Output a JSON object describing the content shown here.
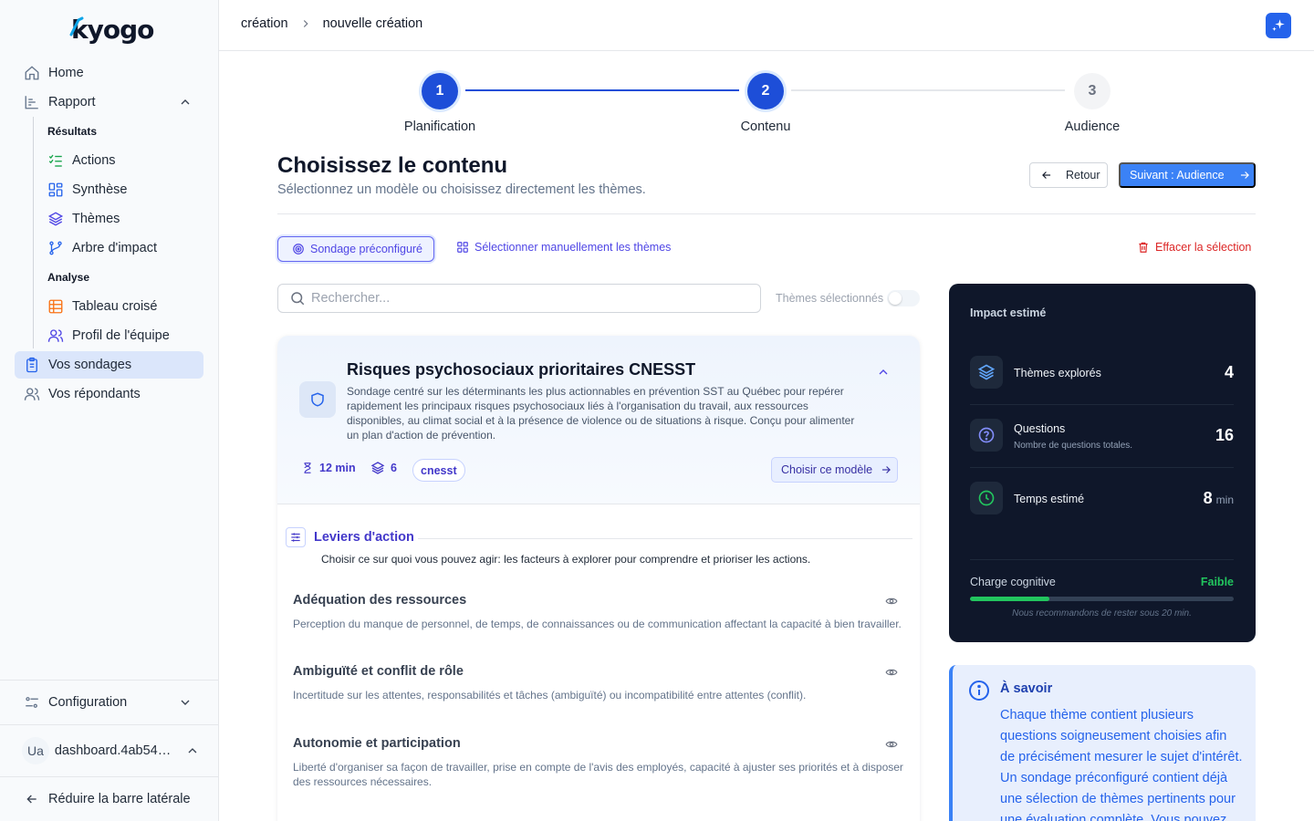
{
  "brand": {
    "logo_text": "kyogo",
    "accent": "#2563eb"
  },
  "sidebar": {
    "home": "Home",
    "rapport": "Rapport",
    "section_results": "Résultats",
    "actions": "Actions",
    "synthese": "Synthèse",
    "themes": "Thèmes",
    "arbre": "Arbre d'impact",
    "section_analysis": "Analyse",
    "tableau": "Tableau croisé",
    "profil": "Profil de l'équipe",
    "sondages": "Vos sondages",
    "repondants": "Vos répondants",
    "configuration": "Configuration",
    "user_initials": "Ua",
    "user_name": "dashboard.4ab541…",
    "collapse": "Réduire la barre latérale"
  },
  "header": {
    "breadcrumb": [
      "création",
      "nouvelle création"
    ]
  },
  "stepper": {
    "steps": [
      {
        "num": "1",
        "label": "Planification",
        "status": "done"
      },
      {
        "num": "2",
        "label": "Contenu",
        "status": "current"
      },
      {
        "num": "3",
        "label": "Audience",
        "status": "todo"
      }
    ]
  },
  "page": {
    "title": "Choisissez le contenu",
    "subtitle": "Sélectionnez un modèle ou choisissez directement les thèmes.",
    "back": "Retour",
    "next": "Suivant : Audience"
  },
  "tabs": {
    "preconfigured": "Sondage préconfiguré",
    "manual": "Sélectionner manuellement les thèmes",
    "clear": "Effacer la sélection"
  },
  "search": {
    "placeholder": "Rechercher...",
    "toggle_label": "Thèmes sélectionnés"
  },
  "template": {
    "title": "Risques psychosociaux prioritaires CNESST",
    "description": "Sondage centré sur les déterminants les plus actionnables en prévention SST au Québec pour repérer rapidement les principaux risques psychosociaux liés à l'organisation du travail, aux ressources disponibles, au climat social et à la présence de violence ou de situations à risque. Conçu pour alimenter un plan d'action de prévention.",
    "duration": "12 min",
    "themes_count": "6",
    "tag": "cnesst",
    "choose": "Choisir ce modèle",
    "category": {
      "title": "Leviers d'action",
      "description": "Choisir ce sur quoi vous pouvez agir: les facteurs à explorer pour comprendre et prioriser les actions."
    },
    "themes": [
      {
        "title": "Adéquation des ressources",
        "description": "Perception du manque de personnel, de temps, de connaissances ou de communication affectant la capacité à bien travailler."
      },
      {
        "title": "Ambiguïté et conflit de rôle",
        "description": "Incertitude sur les attentes, responsabilités et tâches (ambiguïté) ou incompatibilité entre attentes (conflit)."
      },
      {
        "title": "Autonomie et participation",
        "description": "Liberté d'organiser sa façon de travailler, prise en compte de l'avis des employés, capacité à ajuster ses priorités et à disposer des ressources nécessaires."
      }
    ]
  },
  "impact": {
    "title": "Impact estimé",
    "themes_label": "Thèmes explorés",
    "themes_value": "4",
    "questions_label": "Questions",
    "questions_sub": "Nombre de questions totales.",
    "questions_value": "16",
    "time_label": "Temps estimé",
    "time_value": "8",
    "time_unit": "min",
    "charge_label": "Charge cognitive",
    "charge_level": "Faible",
    "charge_fraction": 0.3,
    "charge_note": "Nous recommandons de rester sous 20 min."
  },
  "info": {
    "title": "À savoir",
    "text": "Chaque thème contient plusieurs questions soigneusement choisies afin de précisément mesurer le sujet d'intérêt. Un sondage préconfiguré contient déjà une sélection de thèmes pertinents pour une évaluation complète. Vous pouvez"
  }
}
